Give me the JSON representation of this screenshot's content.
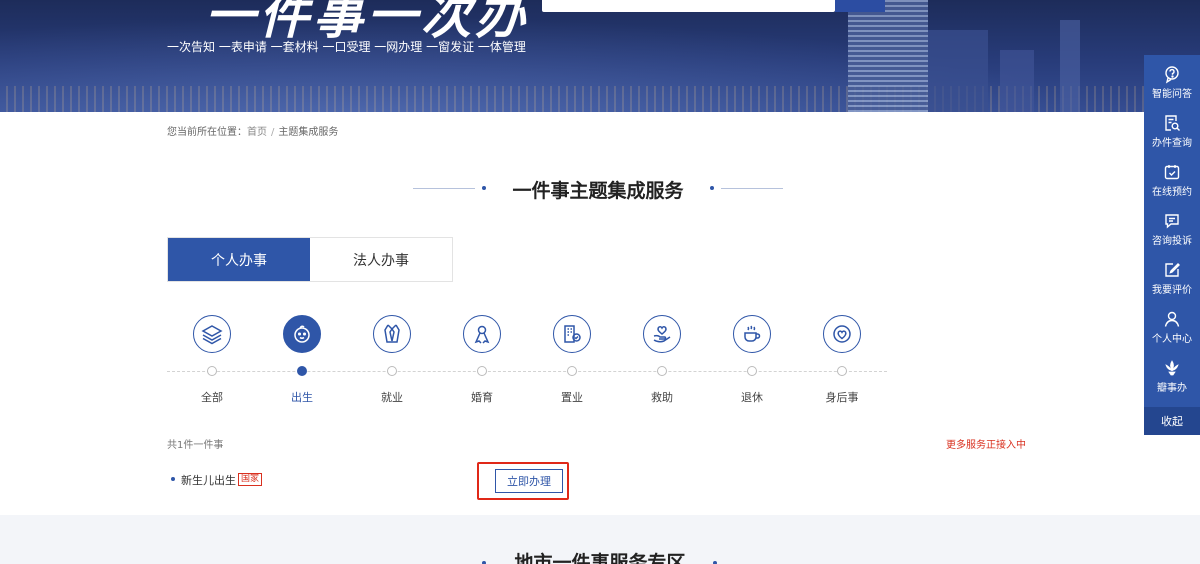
{
  "banner": {
    "title": "一件事一次办",
    "subtitle": "一次告知 一表申请 一套材料 一口受理 一网办理 一窗发证 一体管理"
  },
  "breadcrumb": {
    "prefix": "您当前所在位置：",
    "home": "首页",
    "separator": "/",
    "current": "主题集成服务"
  },
  "section": {
    "title": "一件事主题集成服务"
  },
  "tabs": [
    {
      "label": "个人办事",
      "active": true
    },
    {
      "label": "法人办事",
      "active": false
    }
  ],
  "categories": [
    {
      "label": "全部",
      "icon": "layers-icon",
      "active": false
    },
    {
      "label": "出生",
      "icon": "baby-face-icon",
      "active": true
    },
    {
      "label": "就业",
      "icon": "tie-shirt-icon",
      "active": false
    },
    {
      "label": "婚育",
      "icon": "ribbon-icon",
      "active": false
    },
    {
      "label": "置业",
      "icon": "building-icon",
      "active": false
    },
    {
      "label": "救助",
      "icon": "heart-hand-icon",
      "active": false
    },
    {
      "label": "退休",
      "icon": "coffee-cup-icon",
      "active": false
    },
    {
      "label": "身后事",
      "icon": "heart-circle-icon",
      "active": false
    }
  ],
  "results": {
    "total_text": "共1件一件事",
    "more_text": "更多服务正接入中"
  },
  "service": {
    "name": "新生儿出生",
    "badge": "国家",
    "action": "立即办理"
  },
  "lower": {
    "title": "地市一件事服务专区"
  },
  "sidebar": {
    "items": [
      {
        "label": "智能问答",
        "icon": "chat-bot-icon"
      },
      {
        "label": "办件查询",
        "icon": "document-search-icon"
      },
      {
        "label": "在线预约",
        "icon": "calendar-icon"
      },
      {
        "label": "咨询投诉",
        "icon": "message-icon"
      },
      {
        "label": "我要评价",
        "icon": "edit-icon"
      },
      {
        "label": "个人中心",
        "icon": "user-icon"
      },
      {
        "label": "瓣事办",
        "icon": "lotus-icon"
      }
    ],
    "collapse_label": "收起"
  },
  "colors": {
    "brand": "#2f56a8",
    "alert": "#d9301f",
    "banner": "#283c7a"
  }
}
